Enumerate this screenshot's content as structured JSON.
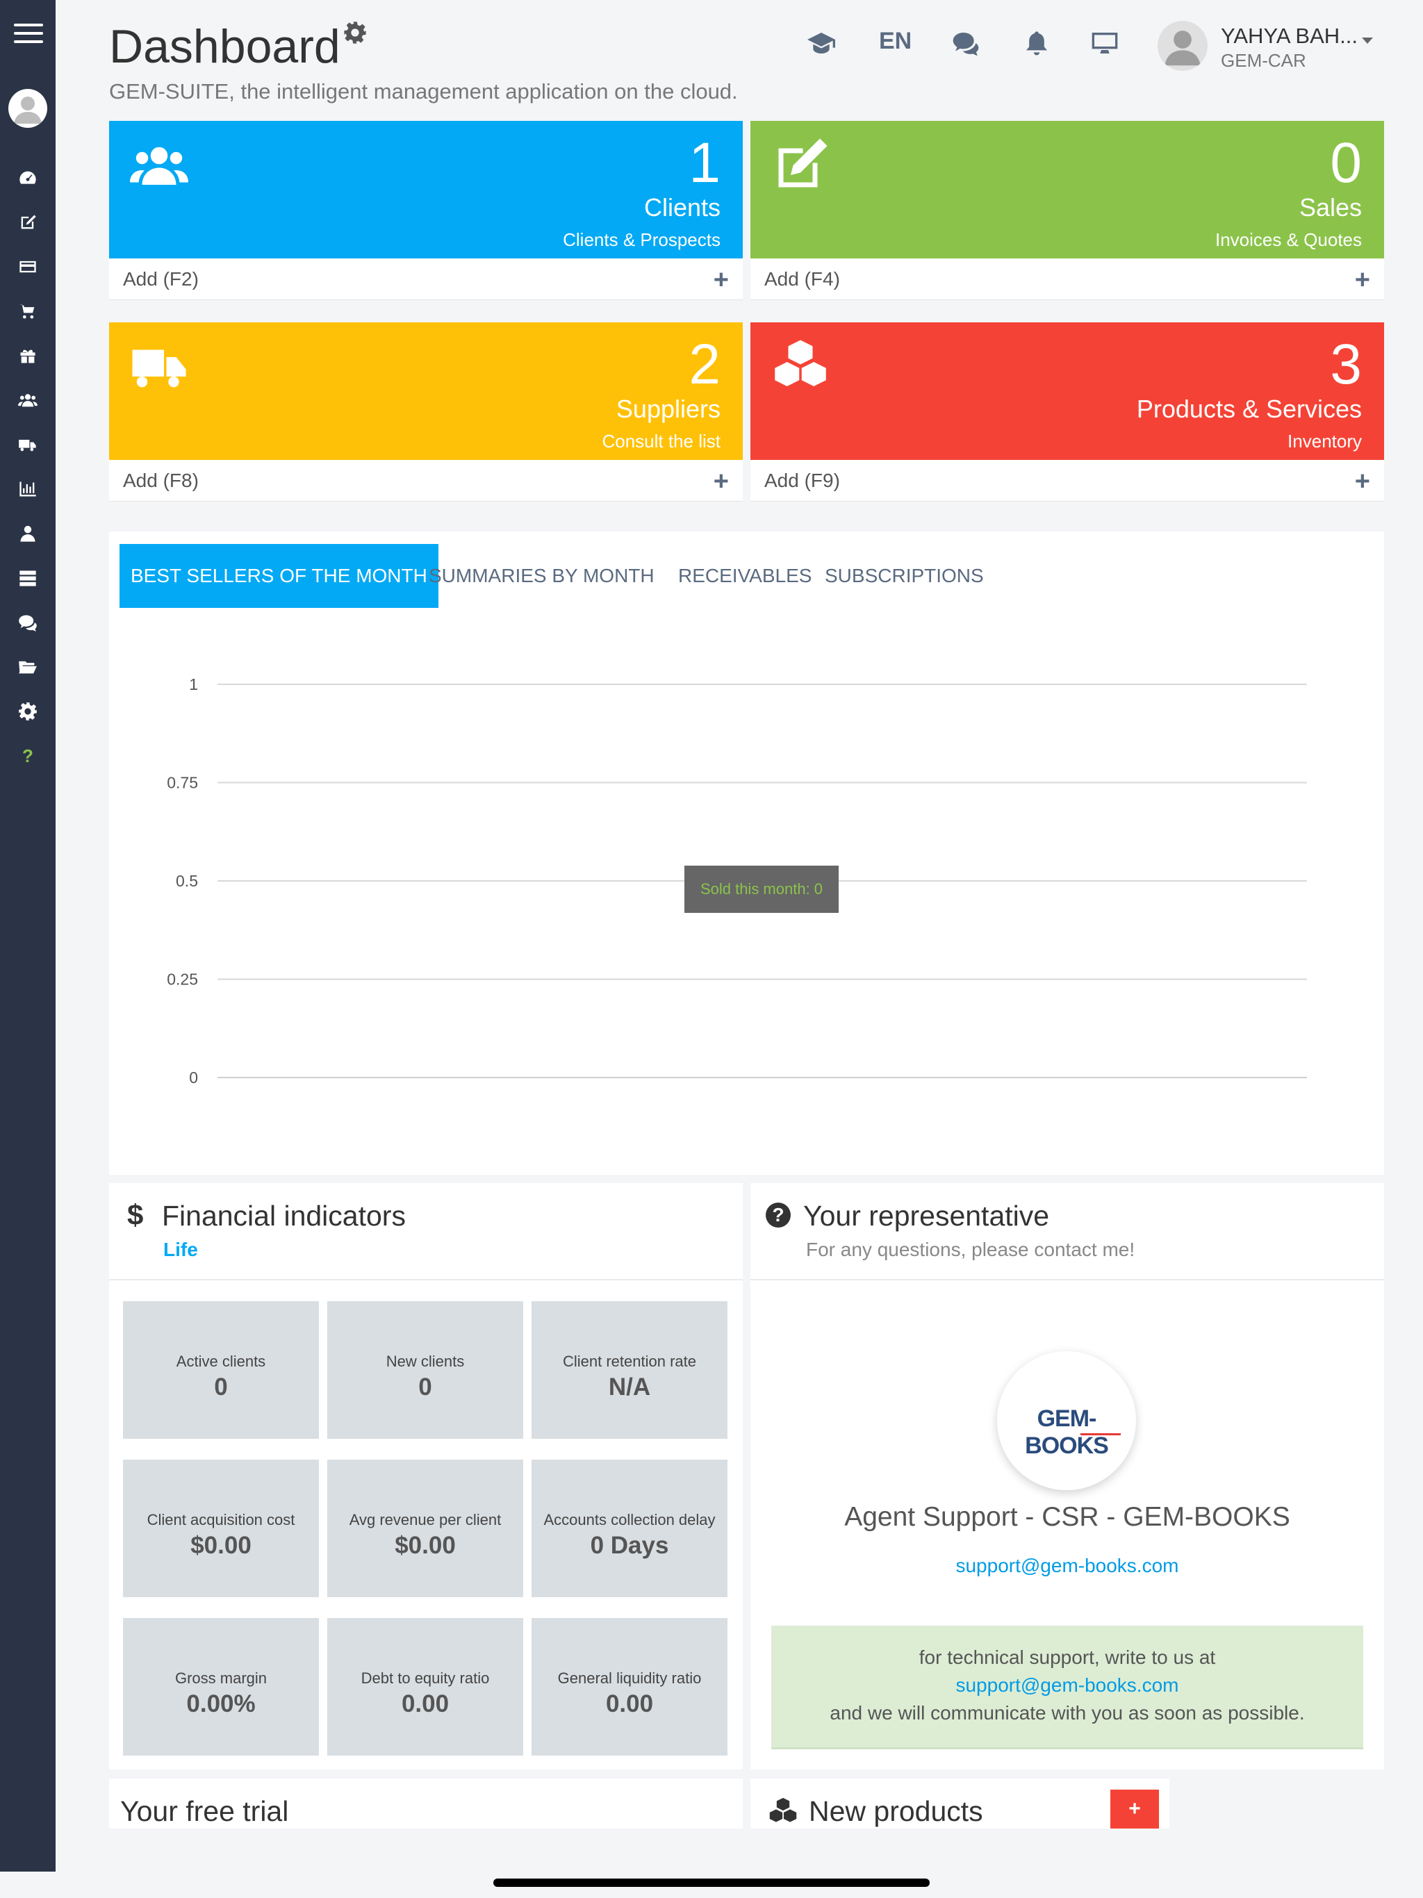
{
  "header": {
    "title": "Dashboard",
    "subtitle": "GEM-SUITE, the intelligent management application on the cloud.",
    "language": "EN",
    "user_name": "YAHYA BAH...",
    "user_org": "GEM-CAR"
  },
  "tiles": [
    {
      "number": "1",
      "label": "Clients",
      "desc": "Clients & Prospects",
      "add": "Add (F2)",
      "color": "#03a9f4",
      "icon": "users-icon"
    },
    {
      "number": "0",
      "label": "Sales",
      "desc": "Invoices & Quotes",
      "add": "Add (F4)",
      "color": "#8bc34a",
      "icon": "edit-icon"
    },
    {
      "number": "2",
      "label": "Suppliers",
      "desc": "Consult the list",
      "add": "Add (F8)",
      "color": "#ffc107",
      "icon": "truck-icon"
    },
    {
      "number": "3",
      "label": "Products & Services",
      "desc": "Inventory",
      "add": "Add (F9)",
      "color": "#f44336",
      "icon": "cubes-icon"
    }
  ],
  "chart_tabs": [
    "BEST SELLERS OF THE MONTH",
    "SUMMARIES BY MONTH",
    "RECEIVABLES",
    "SUBSCRIPTIONS"
  ],
  "chart_data": {
    "type": "bar",
    "categories": [],
    "series": [],
    "y_ticks": [
      "1",
      "0.75",
      "0.5",
      "0.25",
      "0"
    ],
    "ylim": [
      0,
      1
    ],
    "grid": true,
    "tooltip": "Sold this month: 0"
  },
  "financial": {
    "title": "Financial indicators",
    "period": "Life",
    "kpis": [
      {
        "label": "Active clients",
        "value": "0"
      },
      {
        "label": "New clients",
        "value": "0"
      },
      {
        "label": "Client retention rate",
        "value": "N/A"
      },
      {
        "label": "Client acquisition cost",
        "value": "$0.00"
      },
      {
        "label": "Avg revenue per client",
        "value": "$0.00"
      },
      {
        "label": "Accounts collection delay",
        "value": "0 Days"
      },
      {
        "label": "Gross margin",
        "value": "0.00%"
      },
      {
        "label": "Debt to equity ratio",
        "value": "0.00"
      },
      {
        "label": "General liquidity ratio",
        "value": "0.00"
      }
    ]
  },
  "representative": {
    "title": "Your representative",
    "subtitle": "For any questions, please contact me!",
    "logo_text": "GEM-BOOKS",
    "name": "Agent Support - CSR - GEM-BOOKS",
    "email": "support@gem-books.com",
    "alert_line1": "for technical support, write to us at",
    "alert_email": "support@gem-books.com",
    "alert_line2": "and we will communicate with you as soon as possible."
  },
  "bottom": {
    "trial_title": "Your free trial",
    "new_products_title": "New products",
    "add_symbol": "+"
  },
  "colors": {
    "sidebar": "#2b3446",
    "accent": "#03a9f4",
    "icon_gray": "#5a6a80"
  }
}
